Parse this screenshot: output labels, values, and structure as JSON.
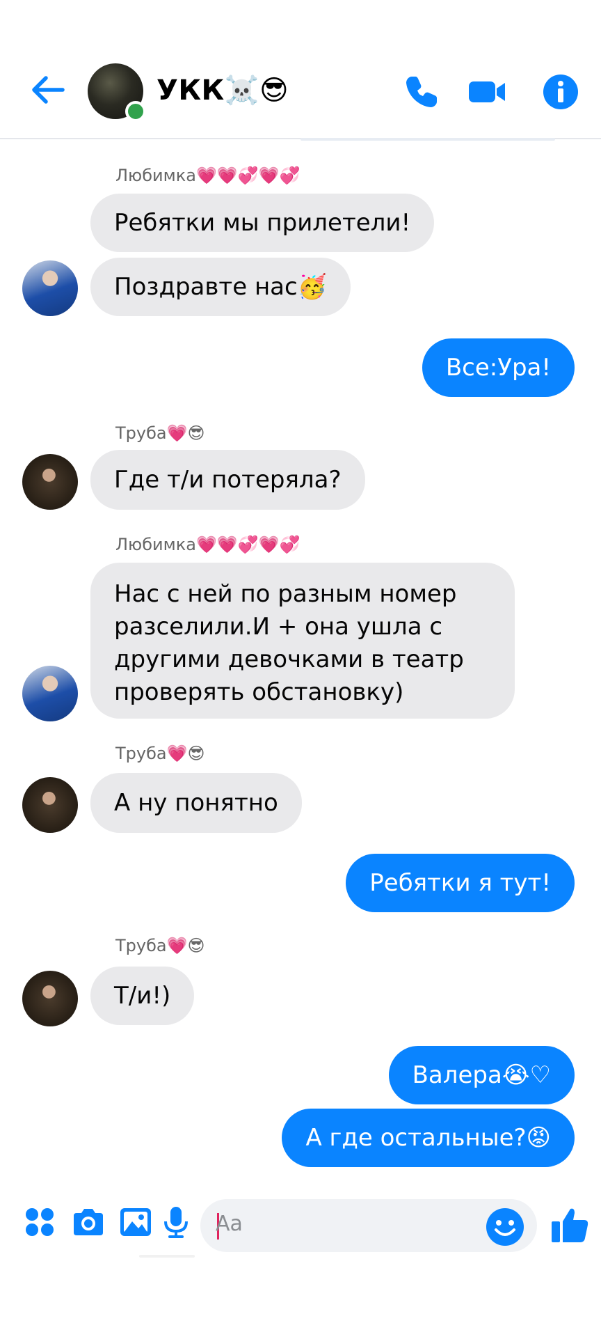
{
  "header": {
    "title": "УКК☠️😎",
    "back_icon": "arrow-left-icon",
    "call_icon": "phone-icon",
    "video_icon": "video-camera-icon",
    "info_icon": "info-icon",
    "accent": "#0a84ff",
    "online_color": "#31a24c"
  },
  "messages": [
    {
      "sender": "Любимка💗💗💞💗💞"
    },
    {
      "text": "Ребятки мы прилетели!"
    },
    {
      "text": "Поздравте нас🥳"
    },
    {
      "text": "Все:Ура!"
    },
    {
      "sender": "Труба💗😎"
    },
    {
      "text": "Где т/и потеряла?"
    },
    {
      "sender": "Любимка💗💗💞💗💞"
    },
    {
      "text": "Нас с ней по разным номер разселили.И + она ушла с другими девочками в театр проверять обстановку)"
    },
    {
      "sender": "Труба💗😎"
    },
    {
      "text": "А ну понятно"
    },
    {
      "text": "Ребятки я тут!"
    },
    {
      "sender": "Труба💗😎"
    },
    {
      "text": "Т/и!)"
    },
    {
      "text": "Валера😭♡"
    },
    {
      "text": "А где остальные?😡"
    }
  ],
  "composer": {
    "placeholder": "Aa",
    "icons": [
      "apps-icon",
      "camera-icon",
      "image-icon",
      "microphone-icon",
      "emoji-icon",
      "thumbs-up-icon"
    ]
  },
  "colors": {
    "incoming_bubble": "#e9e9eb",
    "outgoing_bubble": "#0a84ff",
    "sender_text": "#666666"
  }
}
